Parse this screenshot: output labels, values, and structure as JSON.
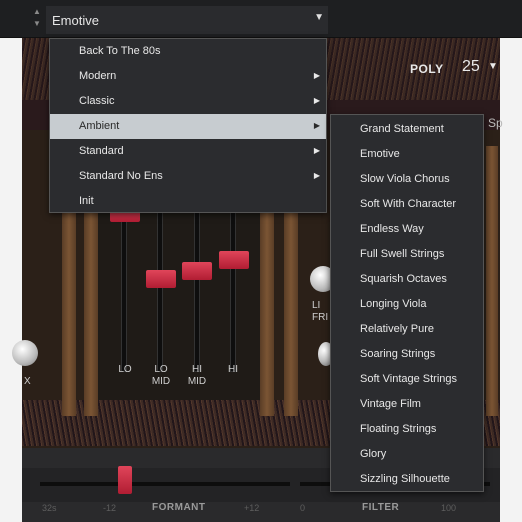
{
  "preset_bar": {
    "current_preset": "Emotive"
  },
  "voice_mode": {
    "label": "POLY",
    "voices": "25"
  },
  "eq": {
    "bands": [
      "LO",
      "LO\nMID",
      "HI\nMID",
      "HI"
    ]
  },
  "partial_labels": {
    "left": "X",
    "right_top": "LI\nFRI",
    "side_tab": "Sp"
  },
  "bottom": {
    "formant_label": "FORMANT",
    "filter_label": "FILTER",
    "ticks": [
      "32s",
      "-12",
      "+12",
      "0",
      "100"
    ]
  },
  "category_menu": {
    "items": [
      {
        "label": "Back To The 80s",
        "submenu": false
      },
      {
        "label": "Modern",
        "submenu": true
      },
      {
        "label": "Classic",
        "submenu": true
      },
      {
        "label": "Ambient",
        "submenu": true,
        "highlighted": true
      },
      {
        "label": "Standard",
        "submenu": true
      },
      {
        "label": "Standard No Ens",
        "submenu": true
      },
      {
        "label": "Init",
        "submenu": false
      }
    ]
  },
  "ambient_submenu": {
    "items": [
      "Grand Statement",
      "Emotive",
      "Slow Viola Chorus",
      "Soft With Character",
      "Endless Way",
      "Full Swell Strings",
      "Squarish Octaves",
      "Longing Viola",
      "Relatively Pure",
      "Soaring Strings",
      "Soft Vintage Strings",
      "Vintage Film",
      "Floating Strings",
      "Glory",
      "Sizzling Silhouette"
    ]
  },
  "colors": {
    "accent": "#c8213a",
    "menu_bg": "#2b2c2f",
    "highlight": "#c7ccd0"
  }
}
